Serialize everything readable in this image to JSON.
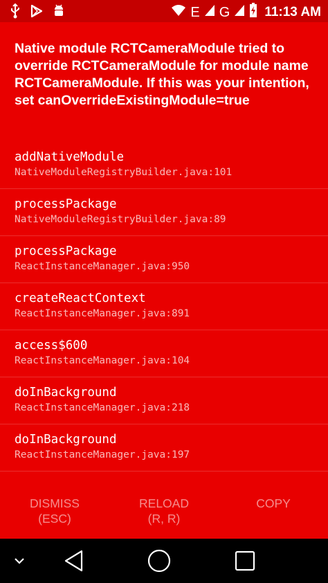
{
  "status_bar": {
    "network_letter_1": "E",
    "network_letter_2": "G",
    "time": "11:13 AM",
    "icons": [
      "usb-icon",
      "play-store-icon",
      "android-debug-icon",
      "wifi-icon",
      "signal-icon",
      "battery-icon"
    ]
  },
  "error": {
    "message": "Native module RCTCameraModule tried to override RCTCameraModule for module name RCTCameraModule. If this was your intention, set canOverrideExistingModule=true"
  },
  "stack_frames": [
    {
      "method": "addNativeModule",
      "file": "NativeModuleRegistryBuilder.java:101"
    },
    {
      "method": "processPackage",
      "file": "NativeModuleRegistryBuilder.java:89"
    },
    {
      "method": "processPackage",
      "file": "ReactInstanceManager.java:950"
    },
    {
      "method": "createReactContext",
      "file": "ReactInstanceManager.java:891"
    },
    {
      "method": "access$600",
      "file": "ReactInstanceManager.java:104"
    },
    {
      "method": "doInBackground",
      "file": "ReactInstanceManager.java:218"
    },
    {
      "method": "doInBackground",
      "file": "ReactInstanceManager.java:197"
    }
  ],
  "actions": {
    "dismiss": {
      "label": "DISMISS",
      "shortcut": "(ESC)"
    },
    "reload": {
      "label": "RELOAD",
      "shortcut": "(R, R)"
    },
    "copy": {
      "label": "COPY"
    }
  },
  "nav_bar": {
    "icons": [
      "chevron-down-icon",
      "back-icon",
      "home-icon",
      "recents-icon"
    ]
  },
  "colors": {
    "background": "#e80000",
    "status_bar": "#c40000",
    "nav_bar": "#000000",
    "text": "#ffffff"
  }
}
